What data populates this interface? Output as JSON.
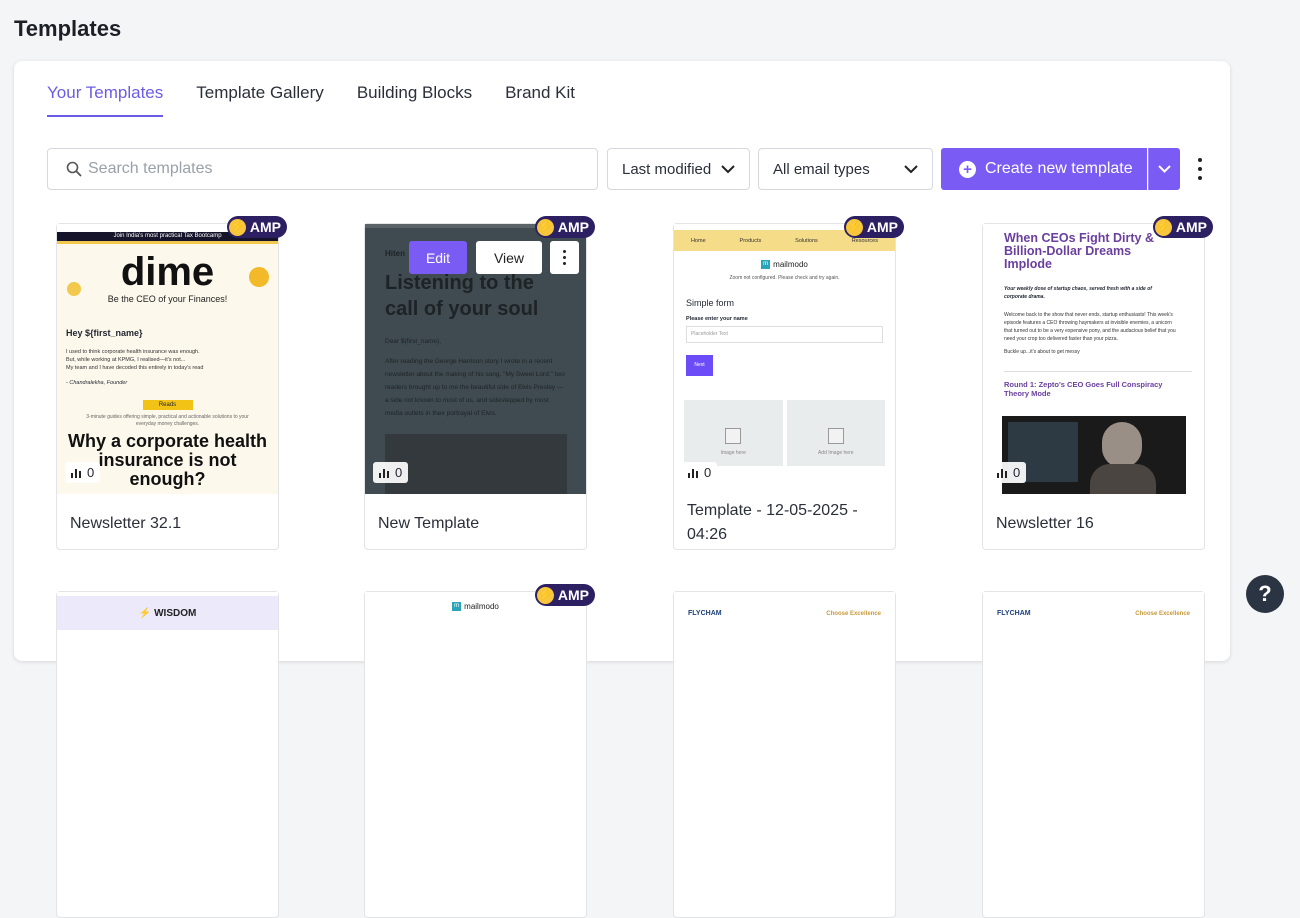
{
  "page": {
    "title": "Templates"
  },
  "tabs": [
    {
      "label": "Your Templates",
      "active": true
    },
    {
      "label": "Template Gallery",
      "active": false
    },
    {
      "label": "Building Blocks",
      "active": false
    },
    {
      "label": "Brand Kit",
      "active": false
    }
  ],
  "search": {
    "placeholder": "Search templates",
    "value": ""
  },
  "filters": {
    "sort_label": "Last modified",
    "type_label": "All email types"
  },
  "create": {
    "label": "Create new template"
  },
  "card_overlay": {
    "edit_label": "Edit",
    "view_label": "View"
  },
  "amp_label": "AMP",
  "cards": [
    {
      "name": "Newsletter 32.1",
      "amp": true,
      "stats": "0",
      "preview": {
        "banner": "Join India's most practical Tax Bootcamp",
        "brand": "dime",
        "tagline": "Be the CEO of your Finances!",
        "greeting": "Hey ${first_name}",
        "lines": [
          "I used to think corporate health insurance was enough.",
          "But, while working at KPMG, I realised—it's not...",
          "My team and I have decoded this entirely in today's read"
        ],
        "signoff": "- Chandralekha, Founder",
        "cta": "Reads",
        "blurb": "3-minute guides offering simple, practical and actionable solutions to your everyday money challenges.",
        "headline": "Why a corporate health insurance is not enough?"
      }
    },
    {
      "name": "New Template",
      "amp": true,
      "stats": "0",
      "preview": {
        "greeting": "Hiten",
        "headline": "Listening to the call of your soul",
        "salutation": "Dear ${first_name},",
        "body": "After reading the George Harrison story I wrote in a recent newsletter about the making of his song, \"My Sweet Lord,\" two readers brought up to me the beautiful side of Elvis Presley — a side not known to most of us, and sidestepped by most media outlets in their portrayal of Elvis."
      }
    },
    {
      "name": "Template - 12-05-2025 - 04:26",
      "amp": true,
      "stats": "0",
      "preview": {
        "nav": [
          "Home",
          "Products",
          "Solutions",
          "Resources"
        ],
        "logo": "mailmodo",
        "notice": "Zoom not configured. Please check and try again.",
        "form_title": "Simple form",
        "field_label": "Please enter your name",
        "field_placeholder": "Placeholder Text",
        "button": "Next",
        "image_captions": [
          "Image here",
          "Add Image here"
        ]
      }
    },
    {
      "name": "Newsletter 16",
      "amp": true,
      "stats": "0",
      "preview": {
        "headline": "When CEOs Fight Dirty & Billion-Dollar Dreams Implode",
        "intro": "Your weekly dose of startup chaos, served fresh with a side of corporate drama.",
        "body": "Welcome back to the show that never ends, startup enthusiasts! This week's episode features a CEO throwing haymakers at invisible enemies, a unicorn that turned out to be a very expensive pony, and the audacious belief that you need your crop too delivered faster than your pizza.",
        "closing": "Buckle up...it's about to get messy",
        "section": "Round 1: Zepto's CEO Goes Full Conspiracy Theory Mode"
      }
    }
  ],
  "row2": [
    {
      "amp": false,
      "label": "WISDOM"
    },
    {
      "amp": true,
      "label": "mailmodo"
    },
    {
      "amp": false,
      "label": "FLYCHAM",
      "tag": "Choose Excellence"
    },
    {
      "amp": false,
      "label": "FLYCHAM",
      "tag": "Choose Excellence"
    }
  ],
  "help": {
    "label": "?"
  }
}
